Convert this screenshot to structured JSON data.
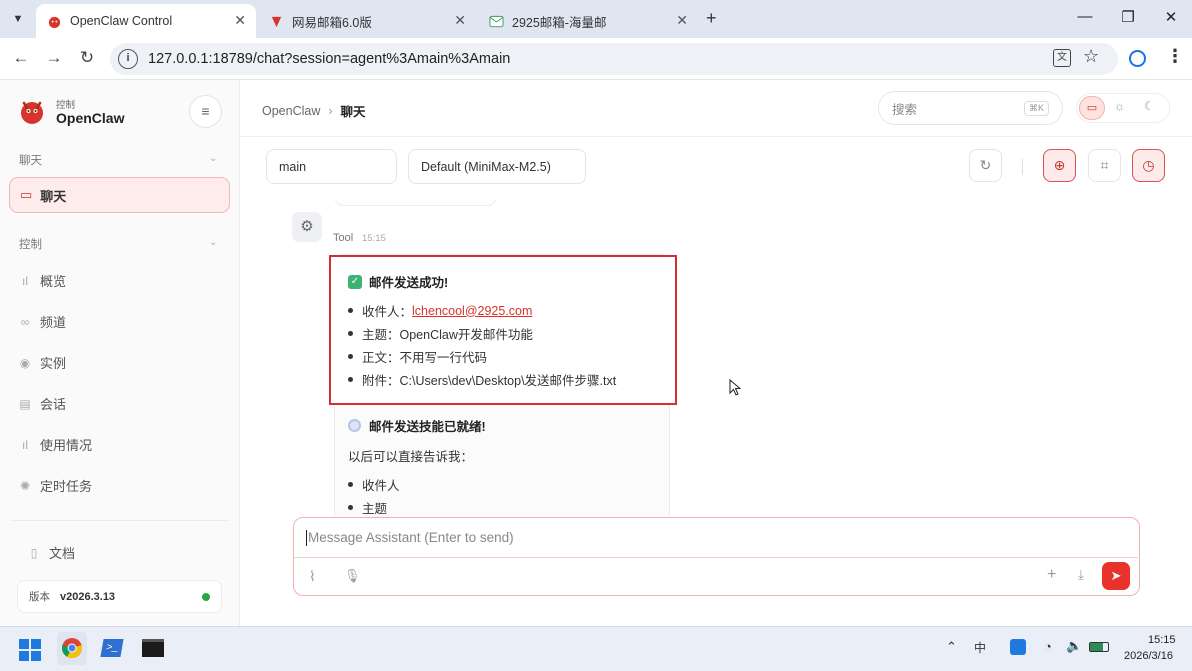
{
  "tabs": [
    {
      "label": "OpenClaw Control",
      "active": true
    },
    {
      "label": "网易邮箱6.0版",
      "active": false
    },
    {
      "label": "2925邮箱-海量邮",
      "active": false
    }
  ],
  "address": {
    "url": "127.0.0.1:18789/chat?session=agent%3Amain%3Amain"
  },
  "brand": {
    "sub": "控制",
    "name": "OpenClaw"
  },
  "sidebar": {
    "section_chat": "聊天",
    "chat_item": "聊天",
    "section_control": "控制",
    "items": [
      {
        "label": "概览",
        "icon": "bar-chart-icon"
      },
      {
        "label": "频道",
        "icon": "link-icon"
      },
      {
        "label": "实例",
        "icon": "broadcast-icon"
      },
      {
        "label": "会话",
        "icon": "document-icon"
      },
      {
        "label": "使用情况",
        "icon": "bar-chart-icon"
      },
      {
        "label": "定时任务",
        "icon": "sun-icon"
      }
    ],
    "docs": "文档",
    "version_label": "版本",
    "version_value": "v2026.3.13"
  },
  "header": {
    "crumb_root": "OpenClaw",
    "crumb_sep": "›",
    "crumb_current": "聊天",
    "search_placeholder": "搜索",
    "search_shortcut": "⌘K"
  },
  "session": {
    "value": "main"
  },
  "model": {
    "value": "Default (MiniMax-M2.5)"
  },
  "message": {
    "author": "Tool",
    "time": "15:15",
    "success_title": "邮件发送成功!",
    "recipient_label": "收件人：",
    "recipient_value": "lchencool@2925.com",
    "subject_line": "主题：OpenClaw开发邮件功能",
    "body_line": "正文：不用写一行代码",
    "attachment_line": "附件：C:\\Users\\dev\\Desktop\\发送邮件步骤.txt",
    "ready_title": "邮件发送技能已就绪!",
    "intro": "以后可以直接告诉我：",
    "list": [
      "收件人",
      "主题"
    ]
  },
  "composer": {
    "placeholder": "Message Assistant (Enter to send)"
  },
  "taskbar": {
    "time": "15:15",
    "date": "2026/3/16",
    "lang": "中"
  },
  "colors": {
    "accent": "#d9342b",
    "highlight_box": "#d32f2f",
    "status_green": "#28a745"
  }
}
